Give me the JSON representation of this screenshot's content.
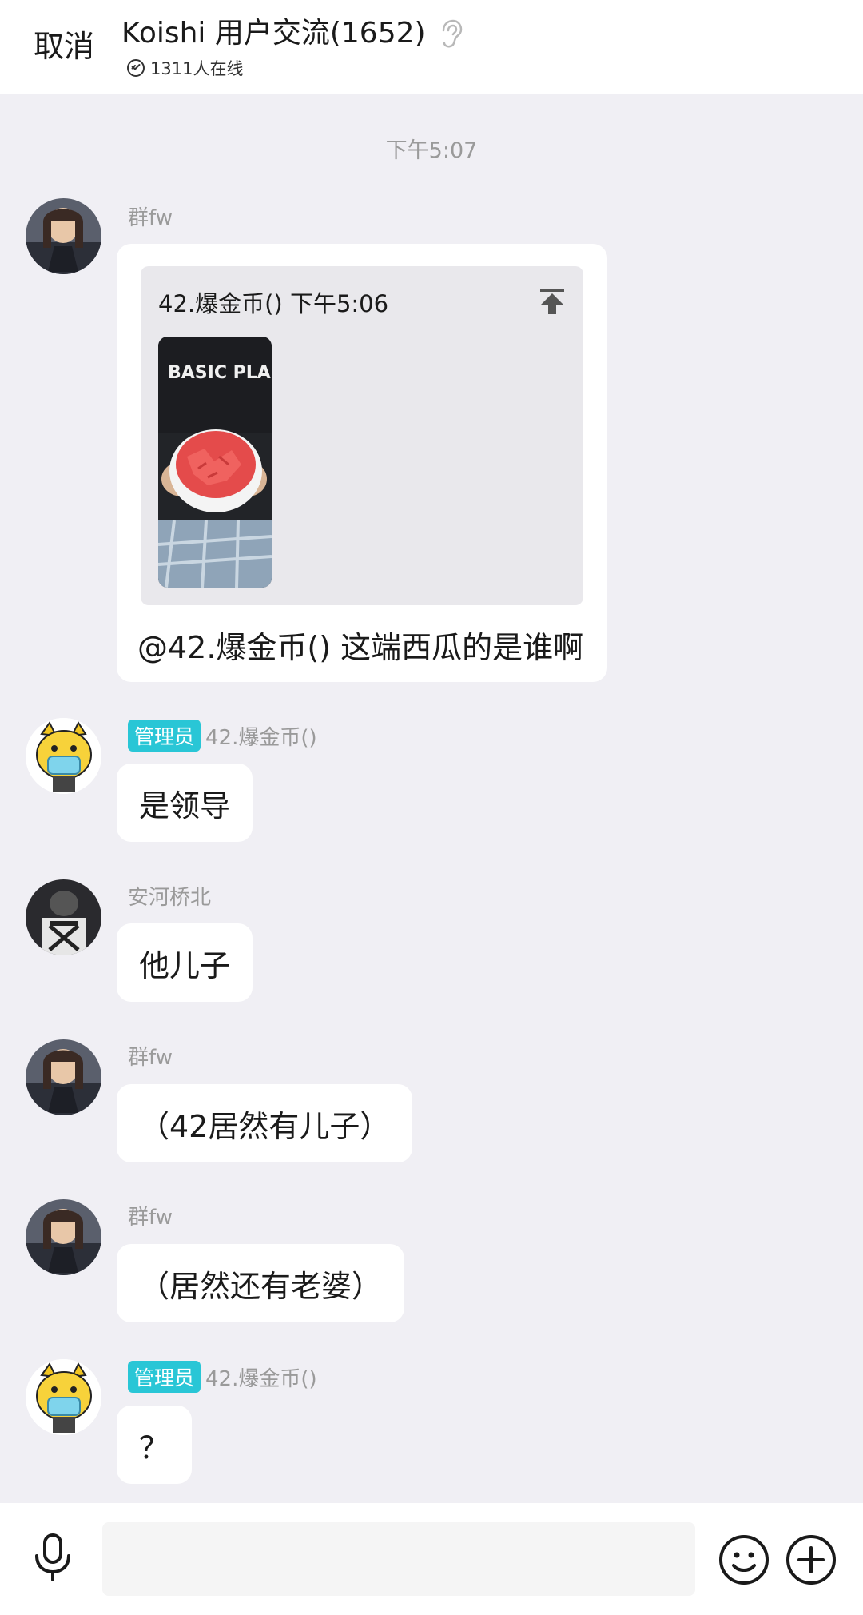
{
  "header": {
    "cancel_label": "取消",
    "title": "Koishi 用户交流(1652)",
    "online": "1311人在线"
  },
  "timestamp": "下午5:07",
  "messages": [
    {
      "sender": "群fw",
      "quote": {
        "author_time": "42.爆金币() 下午5:06",
        "image_text": "BASIC PLAN"
      },
      "text": "@42.爆金币() 这端西瓜的是谁啊"
    },
    {
      "badge": "管理员",
      "sender": "42.爆金币()",
      "text": "是领导"
    },
    {
      "sender": "安河桥北",
      "text": "他儿子"
    },
    {
      "sender": "群fw",
      "text": "（42居然有儿子）"
    },
    {
      "sender": "群fw",
      "text": "（居然还有老婆）"
    },
    {
      "badge": "管理员",
      "sender": "42.爆金币()",
      "text": "？"
    }
  ],
  "input": {
    "placeholder": ""
  },
  "icons": {
    "ear": "ear-icon",
    "online": "check-circle-icon",
    "pin": "pin-top-icon",
    "mic": "microphone-icon",
    "emoji": "emoji-icon",
    "plus": "plus-circle-icon"
  },
  "colors": {
    "background": "#f0eff4",
    "bubble": "#ffffff",
    "admin_badge": "#29c6d6",
    "secondary_text": "#9a9a9a"
  }
}
